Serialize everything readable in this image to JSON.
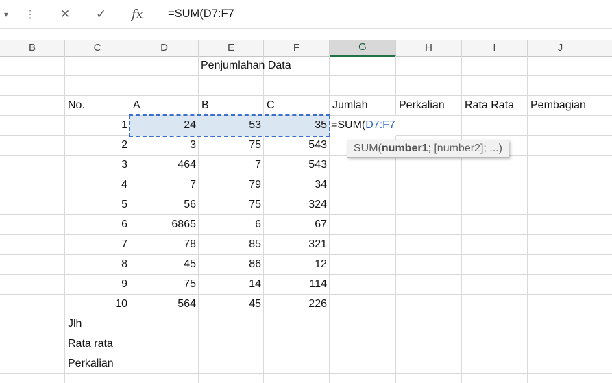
{
  "icons": {
    "caret": "▾",
    "dots": "⋮",
    "cancel": "✕",
    "enter": "✓",
    "fx": "fx"
  },
  "formula_bar": {
    "text": "=SUM(D7:F7"
  },
  "columns": [
    "B",
    "C",
    "D",
    "E",
    "F",
    "G",
    "H",
    "I",
    "J"
  ],
  "selected_column": "G",
  "sheet": {
    "title": "Penjumlahan Data",
    "table_headers": [
      "No.",
      "A",
      "B",
      "C",
      "Jumlah",
      "Perkalian",
      "Rata Rata",
      "Pembagian"
    ],
    "rows": [
      {
        "no": "1",
        "a": "24",
        "b": "53",
        "c": "35"
      },
      {
        "no": "2",
        "a": "3",
        "b": "75",
        "c": "543"
      },
      {
        "no": "3",
        "a": "464",
        "b": "7",
        "c": "543"
      },
      {
        "no": "4",
        "a": "7",
        "b": "79",
        "c": "34"
      },
      {
        "no": "5",
        "a": "56",
        "b": "75",
        "c": "324"
      },
      {
        "no": "6",
        "a": "6865",
        "b": "6",
        "c": "67"
      },
      {
        "no": "7",
        "a": "78",
        "b": "85",
        "c": "321"
      },
      {
        "no": "8",
        "a": "45",
        "b": "86",
        "c": "12"
      },
      {
        "no": "9",
        "a": "75",
        "b": "14",
        "c": "114"
      },
      {
        "no": "10",
        "a": "564",
        "b": "45",
        "c": "226"
      }
    ],
    "footers": [
      "Jlh",
      "Rata rata",
      "Perkalian"
    ]
  },
  "active_cell": {
    "prefix": "=SUM(",
    "reference": "D7:F7"
  },
  "tooltip": {
    "before": "SUM(",
    "arg": "number1",
    "after": "; [number2]; ...)"
  },
  "colors": {
    "accent_green": "#217346",
    "reference_blue": "#2563c9",
    "selection_fill": "#dbe6f3"
  }
}
